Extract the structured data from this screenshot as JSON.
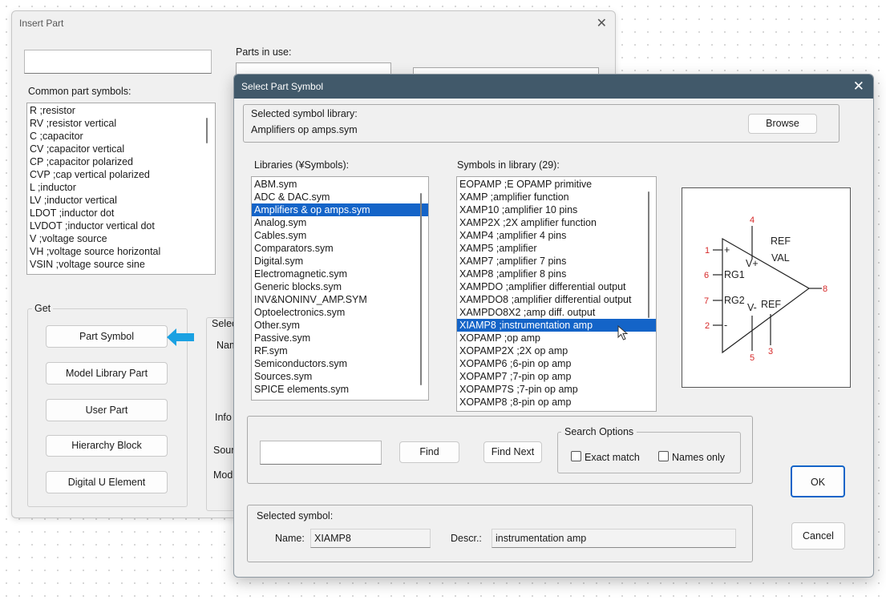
{
  "insert_part": {
    "title": "Insert Part",
    "parts_in_use_label": "Parts in use:",
    "common_label": "Common part symbols:",
    "common_items": [
      "R  ;resistor",
      "RV  ;resistor vertical",
      "C  ;capacitor",
      "CV  ;capacitor vertical",
      "CP  ;capacitor polarized",
      "CVP  ;cap vertical polarized",
      "L  ;inductor",
      "LV  ;inductor vertical",
      "LDOT  ;inductor dot",
      "LVDOT  ;inductor vertical dot",
      "V  ;voltage source",
      "VH  ;voltage source horizontal",
      "VSIN  ;voltage source sine"
    ],
    "get_label": "Get",
    "get_buttons": [
      "Part Symbol",
      "Model Library Part",
      "User Part",
      "Hierarchy Block",
      "Digital U Element"
    ],
    "partial_labels": {
      "sele": "Selec",
      "nam": "Nam",
      "info": "Info",
      "sour": "Sour",
      "mod": "Mod"
    }
  },
  "select_symbol": {
    "title": "Select Part Symbol",
    "selected_lib_label": "Selected symbol library:",
    "selected_lib_value": "Amplifiers  op amps.sym",
    "browse": "Browse",
    "libraries_label": "Libraries (¥Symbols):",
    "libraries": [
      "ABM.sym",
      "ADC & DAC.sym",
      "Amplifiers & op amps.sym",
      "Analog.sym",
      "Cables.sym",
      "Comparators.sym",
      "Digital.sym",
      "Electromagnetic.sym",
      "Generic blocks.sym",
      "INV&NONINV_AMP.SYM",
      "Optoelectronics.sym",
      "Other.sym",
      "Passive.sym",
      "RF.sym",
      "Semiconductors.sym",
      "Sources.sym",
      "SPICE elements.sym"
    ],
    "selected_library_index": 2,
    "symbols_label": "Symbols in library (29):",
    "symbols": [
      "EOPAMP  ;E OPAMP primitive",
      "XAMP  ;amplifier function",
      "XAMP10  ;amplifier 10 pins",
      "XAMP2X  ;2X amplifier function",
      "XAMP4  ;amplifier 4 pins",
      "XAMP5  ;amplifier",
      "XAMP7  ;amplifier 7 pins",
      "XAMP8  ;amplifier 8 pins",
      "XAMPDO  ;amplifier differential output",
      "XAMPDO8  ;amplifier differential output",
      "XAMPDO8X2  ;amp diff. output",
      "XIAMP8  ;instrumentation amp",
      "XOPAMP  ;op amp",
      "XOPAMP2X  ;2X op amp",
      "XOPAMP6  ;6-pin op amp",
      "XOPAMP7  ;7-pin op amp",
      "XOPAMP7S  ;7-pin op amp",
      "XOPAMP8  ;8-pin op amp"
    ],
    "selected_symbol_index": 11,
    "find": "Find",
    "find_next": "Find Next",
    "search_options_label": "Search Options",
    "exact_match": "Exact match",
    "names_only": "Names only",
    "ok": "OK",
    "cancel": "Cancel",
    "selected_symbol_label": "Selected symbol:",
    "name_label": "Name:",
    "name_value": "XIAMP8",
    "descr_label": "Descr.:",
    "descr_value": "instrumentation amp",
    "preview": {
      "pins": [
        "1",
        "2",
        "3",
        "4",
        "5",
        "6",
        "7",
        "8"
      ],
      "labels": [
        "REF",
        "VAL",
        "V+",
        "V-",
        "RG1",
        "RG2",
        "REF",
        "+",
        "-"
      ]
    }
  },
  "colors": {
    "accent": "#1464c8",
    "titlebar": "#41596a",
    "pointer_arrow": "#1ba1e2",
    "pin_red": "#d62828"
  }
}
